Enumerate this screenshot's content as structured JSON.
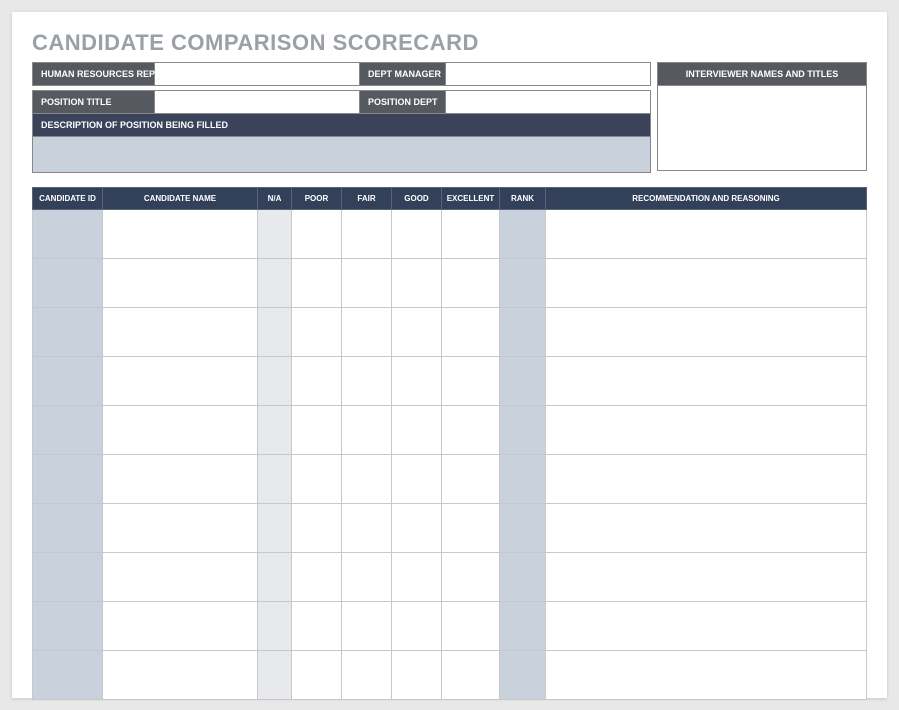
{
  "title": "CANDIDATE COMPARISON SCORECARD",
  "labels": {
    "hr_rep": "HUMAN RESOURCES REP",
    "dept_manager": "DEPT MANAGER",
    "position_title": "POSITION TITLE",
    "position_dept": "POSITION DEPT",
    "description": "DESCRIPTION OF POSITION BEING FILLED",
    "interviewers": "INTERVIEWER NAMES AND TITLES"
  },
  "values": {
    "hr_rep": "",
    "dept_manager": "",
    "position_title": "",
    "position_dept": "",
    "description": "",
    "interviewers": ""
  },
  "columns": {
    "candidate_id": "CANDIDATE ID",
    "candidate_name": "CANDIDATE NAME",
    "na": "N/A",
    "poor": "POOR",
    "fair": "FAIR",
    "good": "GOOD",
    "excellent": "EXCELLENT",
    "rank": "RANK",
    "recommendation": "RECOMMENDATION AND REASONING"
  },
  "rows": [
    {
      "id": "",
      "name": "",
      "na": "",
      "poor": "",
      "fair": "",
      "good": "",
      "excellent": "",
      "rank": "",
      "rec": ""
    },
    {
      "id": "",
      "name": "",
      "na": "",
      "poor": "",
      "fair": "",
      "good": "",
      "excellent": "",
      "rank": "",
      "rec": ""
    },
    {
      "id": "",
      "name": "",
      "na": "",
      "poor": "",
      "fair": "",
      "good": "",
      "excellent": "",
      "rank": "",
      "rec": ""
    },
    {
      "id": "",
      "name": "",
      "na": "",
      "poor": "",
      "fair": "",
      "good": "",
      "excellent": "",
      "rank": "",
      "rec": ""
    },
    {
      "id": "",
      "name": "",
      "na": "",
      "poor": "",
      "fair": "",
      "good": "",
      "excellent": "",
      "rank": "",
      "rec": ""
    },
    {
      "id": "",
      "name": "",
      "na": "",
      "poor": "",
      "fair": "",
      "good": "",
      "excellent": "",
      "rank": "",
      "rec": ""
    },
    {
      "id": "",
      "name": "",
      "na": "",
      "poor": "",
      "fair": "",
      "good": "",
      "excellent": "",
      "rank": "",
      "rec": ""
    },
    {
      "id": "",
      "name": "",
      "na": "",
      "poor": "",
      "fair": "",
      "good": "",
      "excellent": "",
      "rank": "",
      "rec": ""
    },
    {
      "id": "",
      "name": "",
      "na": "",
      "poor": "",
      "fair": "",
      "good": "",
      "excellent": "",
      "rank": "",
      "rec": ""
    },
    {
      "id": "",
      "name": "",
      "na": "",
      "poor": "",
      "fair": "",
      "good": "",
      "excellent": "",
      "rank": "",
      "rec": ""
    }
  ]
}
